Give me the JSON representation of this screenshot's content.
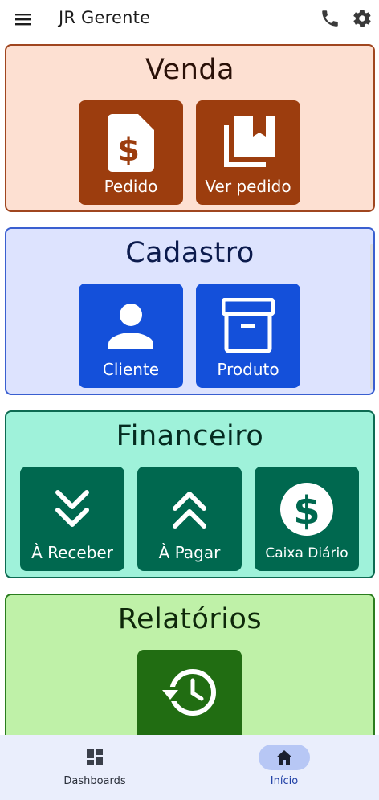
{
  "app": {
    "title": "JR Gerente"
  },
  "sections": {
    "venda": {
      "title": "Venda",
      "tiles": [
        {
          "label": "Pedido"
        },
        {
          "label": "Ver pedido"
        }
      ]
    },
    "cadastro": {
      "title": "Cadastro",
      "tiles": [
        {
          "label": "Cliente"
        },
        {
          "label": "Produto"
        }
      ]
    },
    "financeiro": {
      "title": "Financeiro",
      "tiles": [
        {
          "label": "À Receber"
        },
        {
          "label": "À Pagar"
        },
        {
          "label": "Caixa Diário"
        }
      ]
    },
    "relatorios": {
      "title": "Relatórios",
      "tiles": [
        {
          "label": ""
        }
      ]
    }
  },
  "bottom_nav": [
    {
      "label": "Dashboards",
      "icon": "dashboard-icon",
      "active": false
    },
    {
      "label": "Início",
      "icon": "home-icon",
      "active": true
    }
  ],
  "icons": {
    "menu": "hamburger-menu-icon",
    "phone": "phone-icon",
    "settings": "gear-icon"
  },
  "colors": {
    "venda_bg": "#fde0d2",
    "venda_tile": "#9c3d0e",
    "cadastro_bg": "#dde3fe",
    "cadastro_tile": "#1450da",
    "financeiro_bg": "#9ff2da",
    "financeiro_tile": "#00684f",
    "relatorios_bg": "#bff1a8",
    "relatorios_tile": "#216d12",
    "nav_active": "#b7c7f5"
  }
}
